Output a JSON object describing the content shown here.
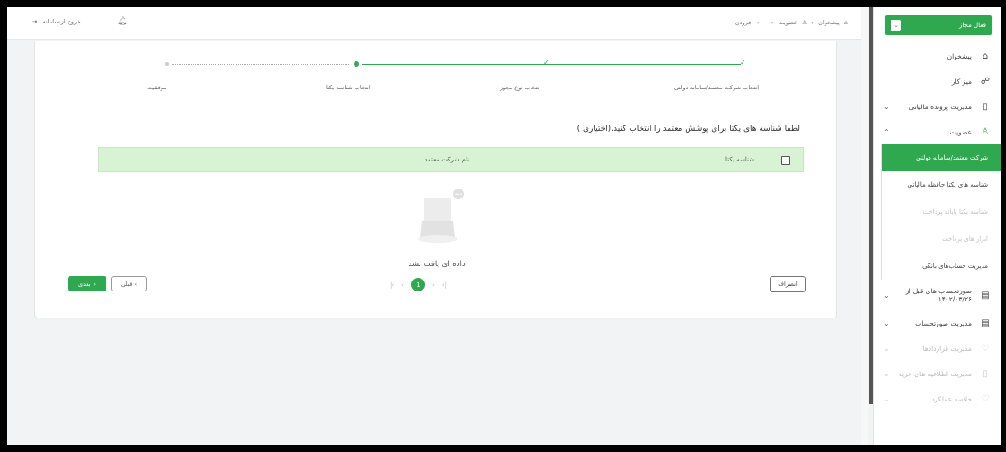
{
  "topbar": {
    "logout_label": "خروج از سامانه",
    "breadcrumbs": [
      "پیشخوان",
      "عضویت",
      "افزودن"
    ]
  },
  "sidebar": {
    "status_label": "فعال مجاز",
    "items": [
      {
        "label": "پیشخوان",
        "icon": "home-icon"
      },
      {
        "label": "میز کار",
        "icon": "workspace-icon"
      },
      {
        "label": "مدیریت پرونده مالیاتی",
        "icon": "file-icon"
      },
      {
        "label": "عضویت",
        "icon": "user-icon"
      },
      {
        "label": "صورتحساب های قبل از ۱۴۰۲/۰۳/۲۶",
        "icon": "invoice-icon"
      },
      {
        "label": "مدیریت صورتحساب",
        "icon": "invoice-icon"
      },
      {
        "label": "مدیریت قراردادها",
        "icon": "contract-icon"
      },
      {
        "label": "مدیریت اطلاعیه های خرید",
        "icon": "notice-icon"
      },
      {
        "label": "خلاصه عملکرد",
        "icon": "summary-icon"
      }
    ],
    "subitems": [
      {
        "label": "شرکت معتمد/سامانه دولتی"
      },
      {
        "label": "شناسه های یکتا حافظه مالیاتی"
      },
      {
        "label": "شناسه یکتا پایانه پرداخت"
      },
      {
        "label": "ابزار های پرداخت"
      },
      {
        "label": "مدیریت حساب‌های بانکی"
      }
    ]
  },
  "stepper": {
    "steps": [
      "انتخاب شرکت معتمد/سامانه دولتی",
      "انتخاب نوع مجوز",
      "انتخاب شناسه یکتا",
      "موفقیت"
    ]
  },
  "main": {
    "instruction": "لطفا شناسه های یکتا برای پوشش معتمد را انتخاب کنید.(اختیاری )",
    "columns": [
      "شناسه یکتا",
      "نام شرکت معتمد"
    ],
    "empty_text": "داده ای یافت نشد",
    "current_page": "1",
    "cancel_label": "انصراف",
    "next_label": "بعدی",
    "prev_label": "قبلی"
  },
  "colors": {
    "accent": "#2fa84f",
    "table_header": "#d8f3d3"
  }
}
